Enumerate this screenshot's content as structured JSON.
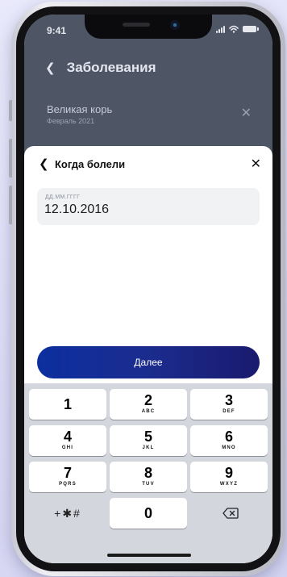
{
  "status": {
    "time": "9:41"
  },
  "background_screen": {
    "title": "Заболевания",
    "item": {
      "name": "Великая корь",
      "date": "Февраль 2021"
    }
  },
  "sheet": {
    "title": "Когда болели",
    "date_field": {
      "hint": "ДД.ММ.ГГГГ",
      "value": "12.10.2016"
    },
    "next_label": "Далее"
  },
  "keyboard": {
    "keys": [
      {
        "digit": "1",
        "letters": ""
      },
      {
        "digit": "2",
        "letters": "ABC"
      },
      {
        "digit": "3",
        "letters": "DEF"
      },
      {
        "digit": "4",
        "letters": "GHI"
      },
      {
        "digit": "5",
        "letters": "JKL"
      },
      {
        "digit": "6",
        "letters": "MNO"
      },
      {
        "digit": "7",
        "letters": "PQRS"
      },
      {
        "digit": "8",
        "letters": "TUV"
      },
      {
        "digit": "9",
        "letters": "WXYZ"
      },
      {
        "digit": "0",
        "letters": ""
      }
    ],
    "symbols_label": "+✱#"
  },
  "colors": {
    "accent_start": "#0c2fa0",
    "accent_end": "#1a1a6e",
    "overlay": "#4e5666",
    "keyboard_bg": "#d4d6dd"
  },
  "icons": [
    "back-chevron-icon",
    "close-icon",
    "delete-backspace-icon",
    "signal-icon",
    "wifi-icon",
    "battery-icon"
  ]
}
